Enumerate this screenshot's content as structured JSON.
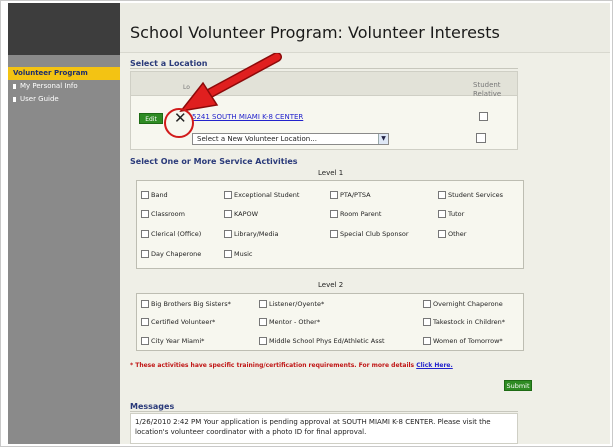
{
  "page": {
    "title": "School Volunteer Program: Volunteer Interests"
  },
  "sidebar": {
    "items": [
      {
        "label": "Volunteer Program",
        "active": true
      },
      {
        "label": "My Personal Info",
        "active": false
      },
      {
        "label": "User Guide",
        "active": false
      }
    ]
  },
  "location": {
    "section_title": "Select a Location",
    "column_label": "Lo",
    "student_relative_label": "Student Relative",
    "edit_label": "Edit",
    "current_location": "5241 SOUTH MIAMI K-8 CENTER",
    "select_placeholder": "Select a New Volunteer Location..."
  },
  "services": {
    "section_title": "Select One or More Service Activities",
    "level1_label": "Level 1",
    "level1": [
      "Band",
      "Exceptional Student",
      "PTA/PTSA",
      "Student Services",
      "Classroom",
      "KAPOW",
      "Room Parent",
      "Tutor",
      "Clerical (Office)",
      "Library/Media",
      "Special Club Sponsor",
      "Other",
      "Day Chaperone",
      "Music"
    ],
    "level2_label": "Level 2",
    "level2": [
      "Big Brothers Big Sisters*",
      "Listener/Oyente*",
      "Overnight Chaperone",
      "Certified Volunteer*",
      "Mentor - Other*",
      "Takestock in Children*",
      "City Year Miami*",
      "Middle School Phys Ed/Athletic Asst",
      "Women of Tomorrow*"
    ]
  },
  "note": {
    "text": "* These activities have specific training/certification requirements. For more details ",
    "link": "Click Here."
  },
  "submit_label": "Submit",
  "messages": {
    "title": "Messages",
    "text": "1/26/2010 2:42 PM Your application is pending approval at SOUTH MIAMI K-8 CENTER. Please visit the location's volunteer coordinator with a photo ID for final approval."
  },
  "colors": {
    "accent_yellow": "#f3c313",
    "button_green": "#2e8b23",
    "annotation_red": "#d11b1b",
    "heading_blue": "#2a3a7a"
  }
}
